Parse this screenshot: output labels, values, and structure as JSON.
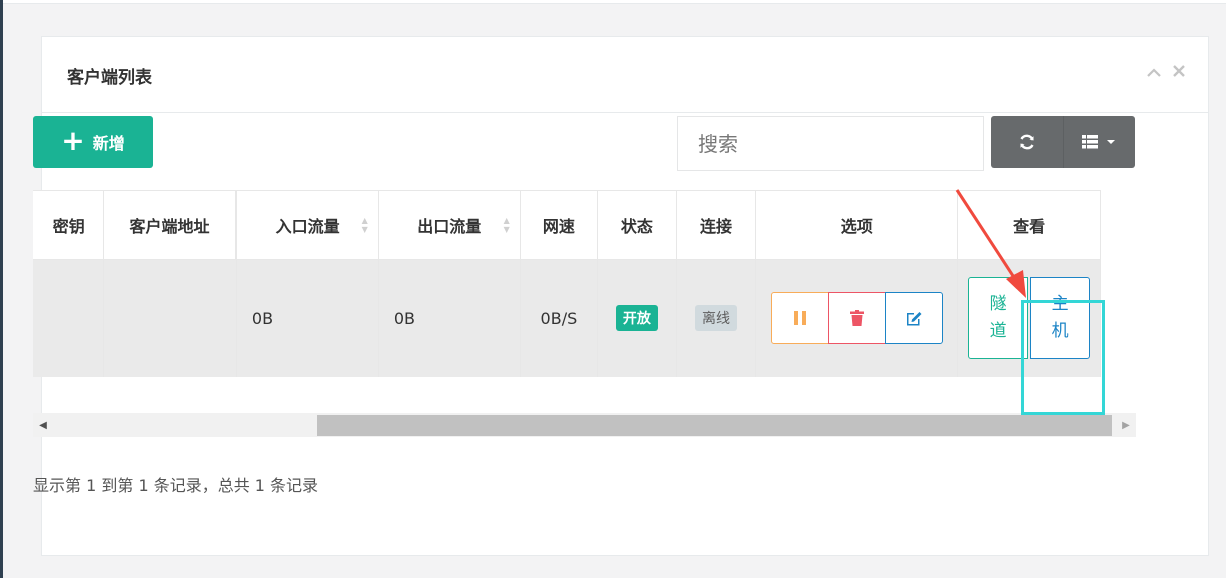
{
  "panel": {
    "title": "客户端列表",
    "tools": {
      "collapse_icon": "chevron-up-icon",
      "close_icon": "close-icon"
    }
  },
  "toolbar": {
    "add_label": "新增",
    "search_placeholder": "搜索",
    "refresh_icon": "refresh-icon",
    "columns_icon": "columns-list-icon"
  },
  "table": {
    "columns": [
      "密钥",
      "客户端地址",
      "入口流量",
      "出口流量",
      "网速",
      "状态",
      "连接",
      "选项",
      "查看"
    ],
    "rows": [
      {
        "key": "",
        "client_address": "",
        "inbound": "0B",
        "outbound": "0B",
        "speed": "0B/S",
        "status": "开放",
        "connection": "离线",
        "view_tunnel": [
          "隧",
          "道"
        ],
        "view_host": [
          "主",
          "机"
        ]
      }
    ]
  },
  "footer": {
    "info": "显示第 1 到第 1 条记录，总共 1 条记录"
  },
  "colors": {
    "primary": "#1ab394",
    "warning": "#f8ac59",
    "danger": "#ed5565",
    "info": "#1c84c6",
    "highlight": "#33d6d6",
    "arrow": "#f04a3e"
  }
}
